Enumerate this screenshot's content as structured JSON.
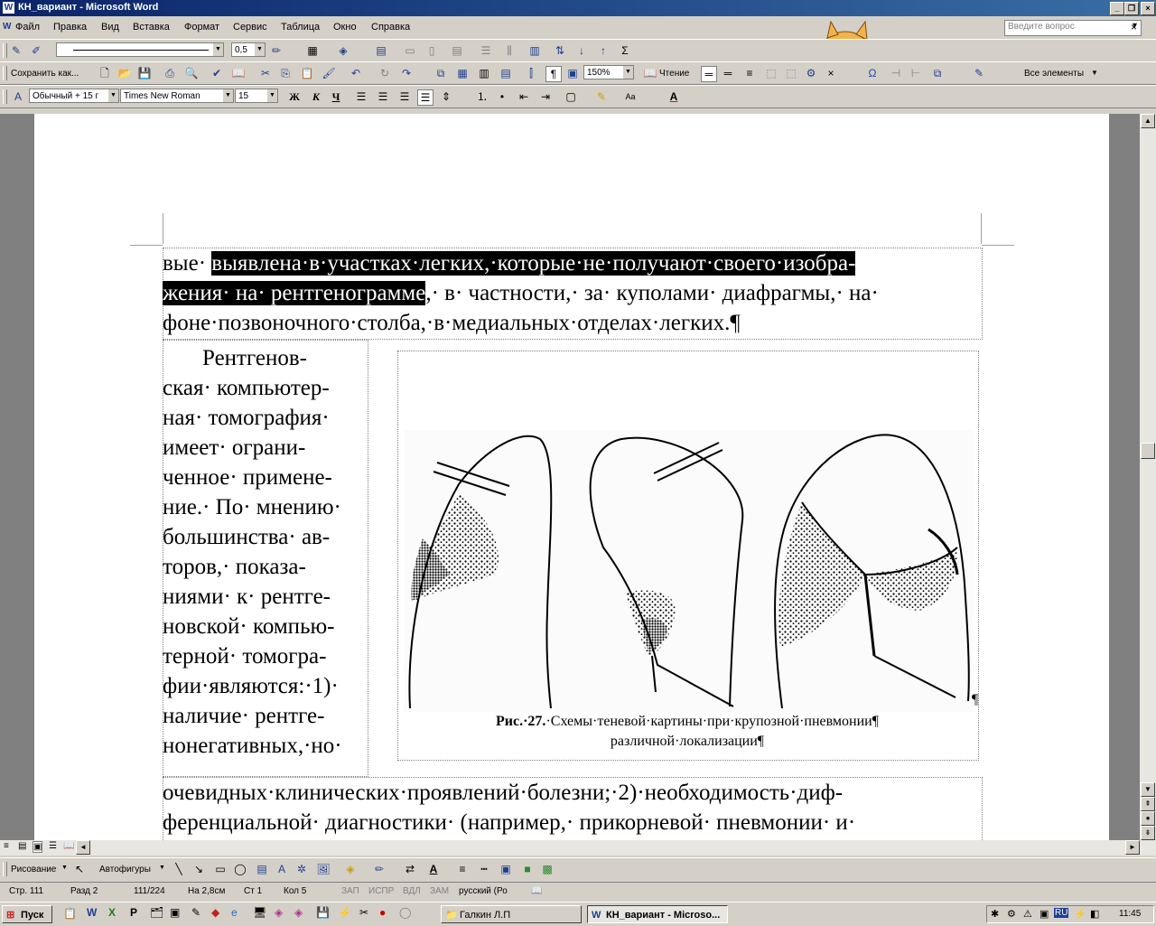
{
  "window": {
    "title": "КН_вариант - Microsoft Word"
  },
  "menu": [
    "Файл",
    "Правка",
    "Вид",
    "Вставка",
    "Формат",
    "Сервис",
    "Таблица",
    "Окно",
    "Справка"
  ],
  "ask_placeholder": "Введите вопрос",
  "toolbar1": {
    "line_width": "0,5"
  },
  "toolbar2": {
    "save_as": "Сохранить как...",
    "zoom": "150%",
    "reading": "Чтение",
    "all_elements": "Все элементы"
  },
  "toolbar3": {
    "style": "Обычный + 15 г",
    "font": "Times New Roman",
    "size": "15"
  },
  "document": {
    "top_lines": [
      [
        "вые· ",
        "выявлена·в·участках·легких,·которые·не·получают·своего·изобра-",
        ""
      ],
      [
        "",
        "жения· на· рентгенограмме",
        ",· в· частности,· за· куполами· диафрагмы,· на·"
      ],
      [
        "фоне·позвоночного·столба,·в·медиальных·отделах·легких.¶",
        "",
        ""
      ]
    ],
    "column_lines": [
      "Рентгенов-",
      "ская· компьютер-",
      "ная· томография·",
      "имеет· ограни-",
      "ченное· примене-",
      "ние.· По· мнению·",
      "большинства· ав-",
      "торов,· показа-",
      "ниями· к· рентге-",
      "новской· компью-",
      "терной· томогра-",
      "фии·являются:·1)·",
      "наличие· рентге-",
      "нонегативных,·но·"
    ],
    "bottom_lines": [
      "очевидных·клинических·проявлений·болезни;·2)·необходимость·диф-",
      "ференциальной· диагностики· (например,· прикорневой· пневмонии· и·"
    ],
    "figure_caption_bold": "Рис.·27.",
    "figure_caption_1": "·Схемы·теневой·картины·при·крупозной·пневмонии¶",
    "figure_caption_2": "различной·локализации¶",
    "pilcrow": "¶"
  },
  "drawing_toolbar": {
    "draw": "Рисование",
    "autoshapes": "Автофигуры"
  },
  "status": {
    "page": "Стр. 111",
    "section": "Разд 2",
    "pages": "111/224",
    "at": "На 2,8см",
    "line": "Ст 1",
    "col": "Кол 5",
    "rec": "ЗАП",
    "trk": "ИСПР",
    "ext": "ВДЛ",
    "ovr": "ЗАМ",
    "lang": "русский (Ро"
  },
  "taskbar": {
    "start": "Пуск",
    "task1": "Галкин Л.П",
    "task2": "КН_вариант - Microso...",
    "clock": "11:45",
    "lang": "RU"
  }
}
